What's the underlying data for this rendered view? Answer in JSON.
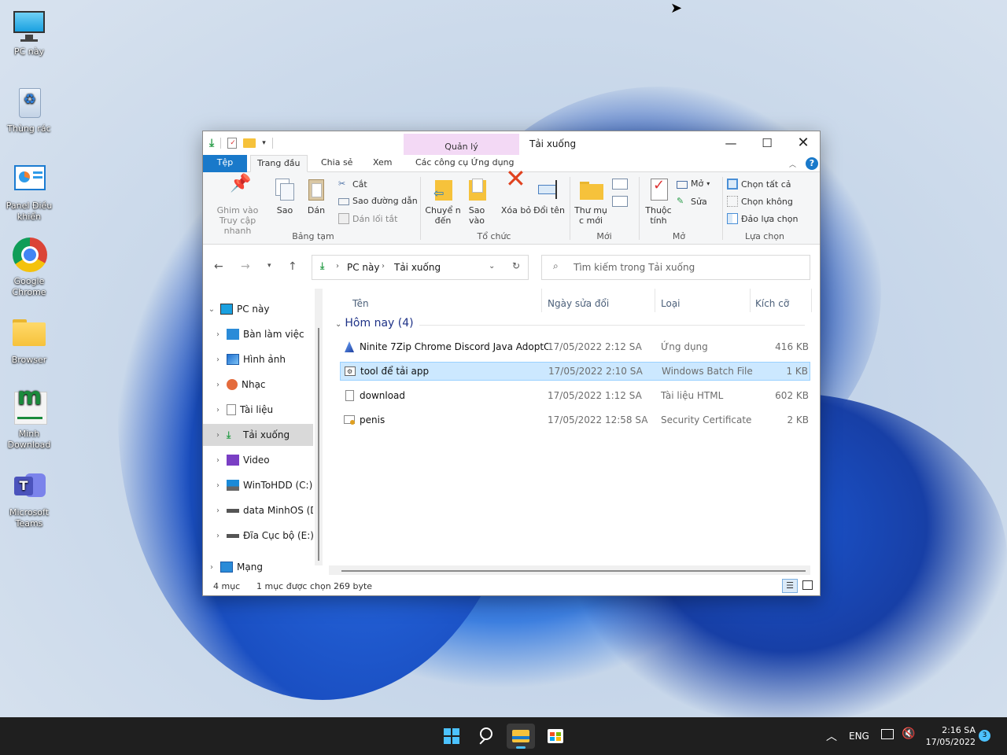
{
  "desktop": {
    "icons": [
      {
        "label": "PC này"
      },
      {
        "label": "Thùng rác"
      },
      {
        "label": "Panel Điều khiển"
      },
      {
        "label": "Google Chrome"
      },
      {
        "label": "Browser"
      },
      {
        "label": "Minh Download"
      },
      {
        "label": "Microsoft Teams"
      }
    ]
  },
  "window": {
    "title": "Tải xuống",
    "context_tab_title": "Quản lý",
    "tabs": {
      "file": "Tệp",
      "home": "Trang đầu",
      "share": "Chia sẻ",
      "view": "Xem",
      "app_tools": "Các công cụ Ứng dụng"
    },
    "ribbon": {
      "pin": "Ghim vào Truy cập nhanh",
      "copy": "Sao",
      "paste": "Dán",
      "cut": "Cắt",
      "copy_path": "Sao đường dẫn",
      "paste_shortcut": "Dán lối tắt",
      "clipboard_group": "Bảng tạm",
      "move_to": "Chuyể n đến",
      "copy_to": "Sao vào",
      "delete": "Xóa bỏ",
      "rename": "Đổi tên",
      "organize_group": "Tổ chức",
      "new_folder": "Thư mụ c mới",
      "new_group": "Mới",
      "properties": "Thuộc tính",
      "open": "Mở",
      "edit": "Sửa",
      "open_group": "Mở",
      "select_all": "Chọn tất cả",
      "select_none": "Chọn không",
      "invert_selection": "Đảo lựa chọn",
      "select_group": "Lựa chọn"
    },
    "address": {
      "root": "PC này",
      "current": "Tải xuống"
    },
    "search": {
      "placeholder": "Tìm kiếm trong Tải xuống"
    },
    "nav": [
      {
        "label": "PC này"
      },
      {
        "label": "Bàn làm việc"
      },
      {
        "label": "Hình ảnh"
      },
      {
        "label": "Nhạc"
      },
      {
        "label": "Tài liệu"
      },
      {
        "label": "Tải xuống"
      },
      {
        "label": "Video"
      },
      {
        "label": "WinToHDD (C:)"
      },
      {
        "label": "data MinhOS (D"
      },
      {
        "label": "Đĩa Cục bộ (E:)"
      },
      {
        "label": "Mạng"
      }
    ],
    "columns": {
      "name": "Tên",
      "date": "Ngày sửa đổi",
      "type": "Loại",
      "size": "Kích cỡ"
    },
    "group_header": "Hôm nay (4)",
    "files": [
      {
        "name": "Ninite 7Zip Chrome Discord Java AdoptO...",
        "date": "17/05/2022 2:12 SA",
        "type": "Ứng dụng",
        "size": "416 KB"
      },
      {
        "name": "tool để tải app",
        "date": "17/05/2022 2:10 SA",
        "type": "Windows Batch File",
        "size": "1 KB"
      },
      {
        "name": "download",
        "date": "17/05/2022 1:12 SA",
        "type": "Tài liệu HTML",
        "size": "602 KB"
      },
      {
        "name": "penis",
        "date": "17/05/2022 12:58 SA",
        "type": "Security Certificate",
        "size": "2 KB"
      }
    ],
    "status": {
      "count": "4 mục",
      "selected": "1 mục được chọn",
      "size": "269 byte"
    }
  },
  "taskbar": {
    "lang": "ENG",
    "time": "2:16 SA",
    "date": "17/05/2022",
    "notifications": "3"
  }
}
